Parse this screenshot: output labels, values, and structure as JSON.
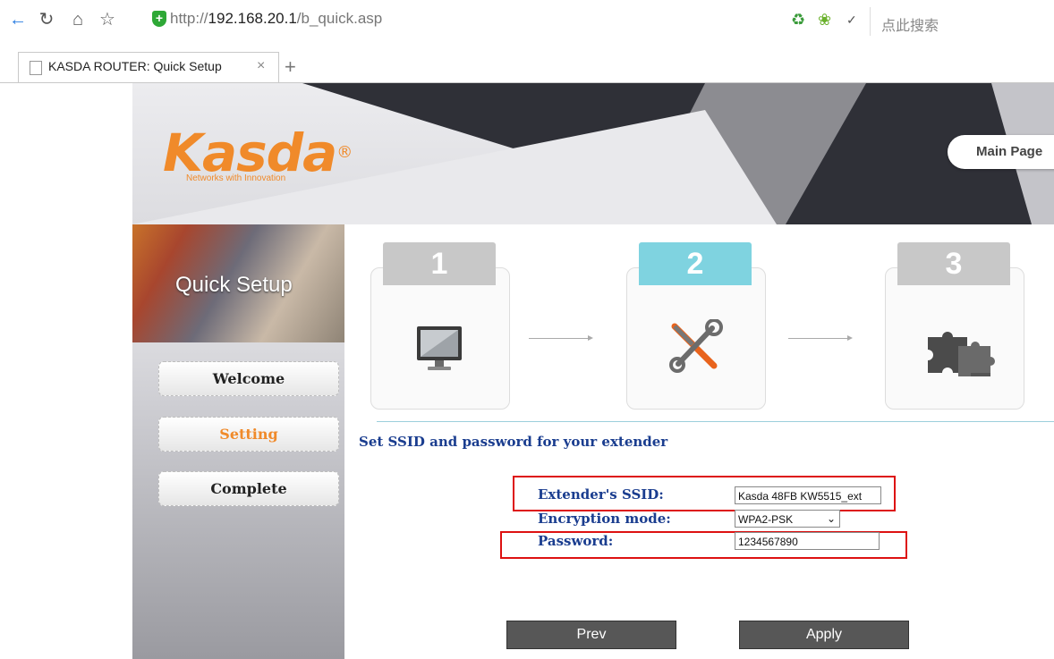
{
  "browser": {
    "url_prefix": "http://",
    "url_host": "192.168.20.1",
    "url_path": "/b_quick.asp",
    "search_placeholder": "点此搜索",
    "tab_title": "KASDA ROUTER: Quick Setup"
  },
  "header": {
    "logo_text": "Kasda",
    "logo_mark": "®",
    "tagline": "Networks with Innovation",
    "main_page_label": "Main Page"
  },
  "sidebar": {
    "banner_title": "Quick Setup",
    "items": [
      {
        "label": "Welcome",
        "color": "#222222"
      },
      {
        "label": "Setting",
        "color": "#f08a2a"
      },
      {
        "label": "Complete",
        "color": "#222222"
      }
    ]
  },
  "steps": [
    {
      "number": "1",
      "icon": "monitor-icon"
    },
    {
      "number": "2",
      "icon": "tools-icon"
    },
    {
      "number": "3",
      "icon": "puzzle-icon"
    }
  ],
  "form": {
    "subtitle": "Set SSID and password for your extender",
    "ssid_label": "Extender's SSID:",
    "ssid_value": "Kasda 48FB KW5515_ext",
    "enc_label": "Encryption mode:",
    "enc_value": "WPA2-PSK",
    "pwd_label": "Password:",
    "pwd_value": "1234567890"
  },
  "actions": {
    "prev_label": "Prev",
    "apply_label": "Apply"
  },
  "colors": {
    "accent_orange": "#f08a2a",
    "label_blue": "#1a3d8f",
    "active_step": "#7fd3e0",
    "highlight_red": "#dd1111"
  }
}
